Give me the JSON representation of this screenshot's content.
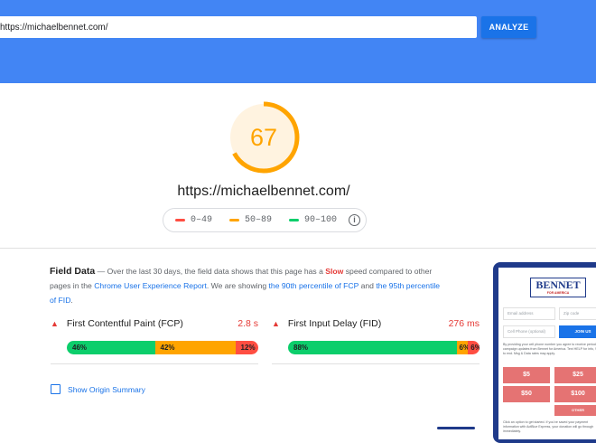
{
  "header": {
    "url_value": "https://michaelbennet.com/",
    "analyze_label": "ANALYZE"
  },
  "score": {
    "value": "67",
    "fraction": 0.67,
    "color": "#ffa400",
    "track_color": "#fff3e0"
  },
  "page_url": "https://michaelbennet.com/",
  "legend": [
    {
      "label": "0–49",
      "color": "#ff4e42"
    },
    {
      "label": "50–89",
      "color": "#ffa400"
    },
    {
      "label": "90–100",
      "color": "#0cce6b"
    }
  ],
  "field_data": {
    "title": "Field Data",
    "dash": "—",
    "text1": "Over the last 30 days, the field data shows that this page has a",
    "speed": "Slow",
    "text2": "speed compared to other pages in the",
    "crux_link": "Chrome User Experience Report",
    "text3": ". We are showing",
    "fcp_link": "the 90th percentile of FCP",
    "text4": "and",
    "fid_link": "the 95th percentile of FID",
    "text5": "."
  },
  "metrics": [
    {
      "name": "First Contentful Paint (FCP)",
      "value": "2.8 s",
      "distribution": [
        {
          "label": "46%",
          "pct": 46,
          "color": "#0cce6b"
        },
        {
          "label": "42%",
          "pct": 42,
          "color": "#ffa400"
        },
        {
          "label": "12%",
          "pct": 12,
          "color": "#ff4e42"
        }
      ]
    },
    {
      "name": "First Input Delay (FID)",
      "value": "276 ms",
      "distribution": [
        {
          "label": "88%",
          "pct": 88,
          "color": "#0cce6b"
        },
        {
          "label": "6%",
          "pct": 6,
          "color": "#ffa400"
        },
        {
          "label": "6%",
          "pct": 6,
          "color": "#ff4e42"
        }
      ]
    }
  ],
  "origin_summary_label": "Show Origin Summary",
  "preview": {
    "logo": "BENNET",
    "logo_sub": "FOR AMERICA",
    "email_placeholder": "Email address",
    "zip_placeholder": "Zip code",
    "phone_placeholder": "Cell Phone (optional)",
    "join_label": "JOIN US",
    "fine_print": "By providing your cell phone number you agree to receive periodic campaign updates from Bennet for America. Text HELP for info, STOP to end. Msg & Data rates may apply.",
    "amounts": [
      "$5",
      "$25",
      "$50",
      "$100",
      "OTHER"
    ],
    "footer_print": "Click an option to get started. If you've saved your payment information with ActBlue Express, your donation will go through immediately."
  }
}
